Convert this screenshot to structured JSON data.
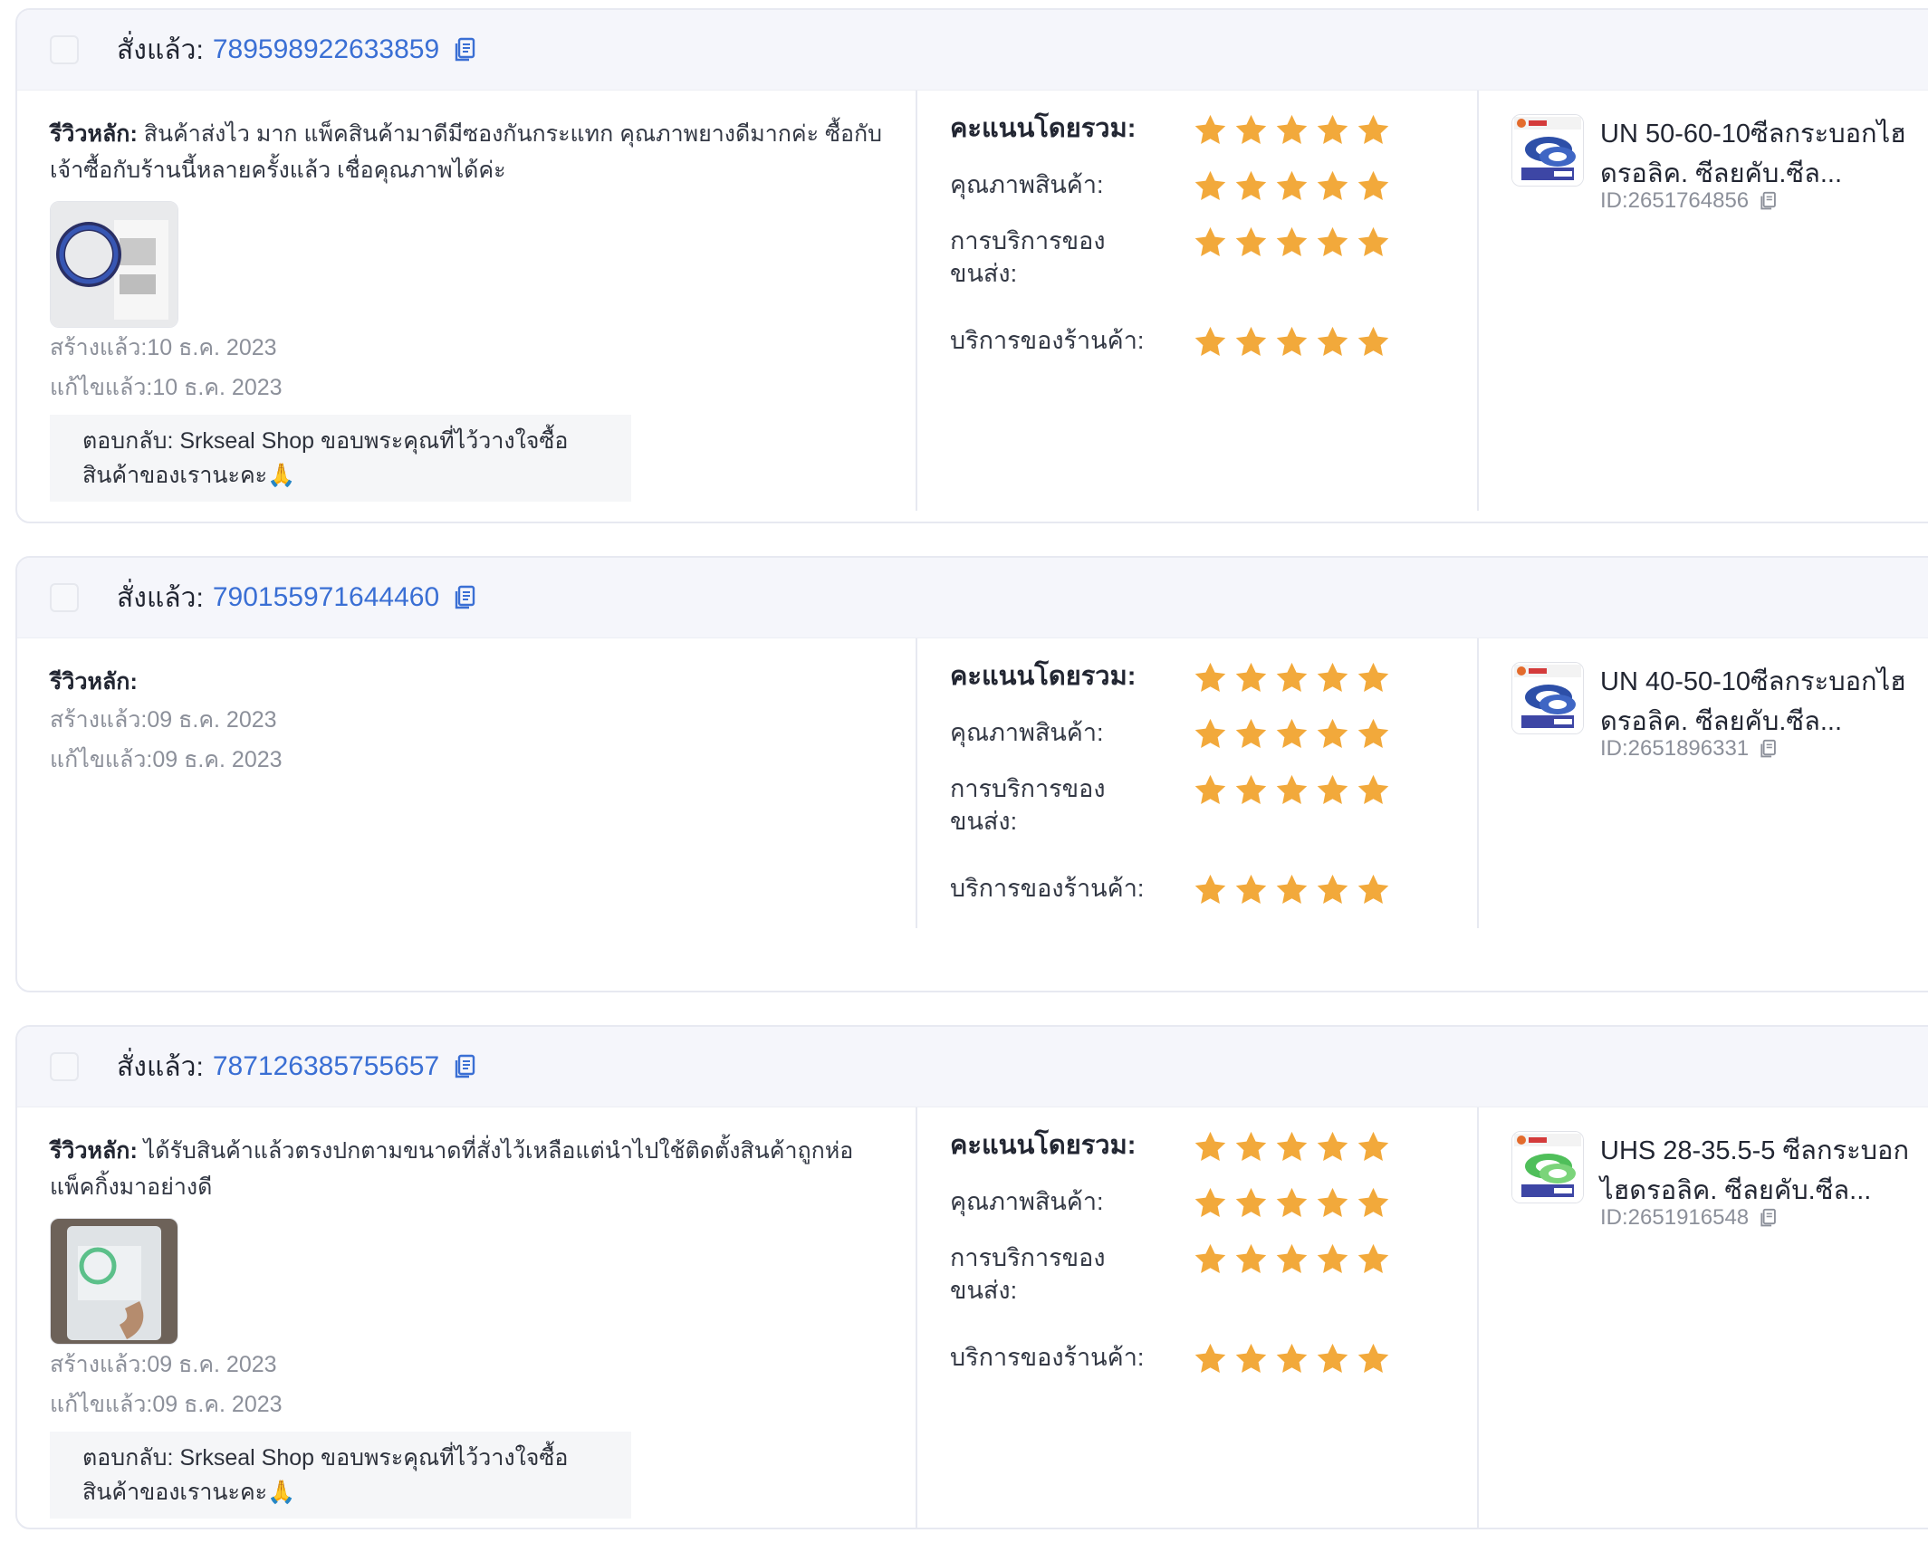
{
  "accent_color": "#3a6fd4",
  "star_color": "#f2a93b",
  "labels": {
    "ordered": "สั่งแล้ว:",
    "main_review": "รีวิวหลัก:",
    "created": "สร้างแล้ว:",
    "edited": "แก้ไขแล้ว:",
    "overall": "คะแนนโดยรวม:",
    "product_quality": "คุณภาพสินค้า:",
    "shipping_service": "การบริการของขนส่ง:",
    "shop_service": "บริการของร้านค้า:",
    "id_prefix": "ID: "
  },
  "reviews": [
    {
      "order_no": "789598922633859",
      "review_text": "สินค้าส่งไว มาก แพ็คสินค้ามาดีมีซองกันกระแทก คุณภาพยางดีมากค่ะ ซื้อกับเจ้าซื้อกับร้านนี้หลายครั้งแล้ว เชื่อคุณภาพได้ค่ะ",
      "has_photo": true,
      "created": "10 ธ.ค. 2023",
      "edited": "10 ธ.ค. 2023",
      "reply": "ตอบกลับ: Srkseal Shop ขอบพระคุณที่ไว้วางใจซื้อสินค้าของเรานะคะ🙏",
      "ratings": {
        "overall": 5,
        "product_quality": 5,
        "shipping_service": 5,
        "shop_service": 5
      },
      "product": {
        "name": "UN 50-60-10ซีลกระบอกไฮดรอลิค. ซีลยคับ.ซีล...",
        "id": "2651764856"
      }
    },
    {
      "order_no": "790155971644460",
      "review_text": "",
      "has_photo": false,
      "created": "09 ธ.ค. 2023",
      "edited": "09 ธ.ค. 2023",
      "reply": "",
      "ratings": {
        "overall": 5,
        "product_quality": 5,
        "shipping_service": 5,
        "shop_service": 5
      },
      "product": {
        "name": "UN 40-50-10ซีลกระบอกไฮดรอลิค. ซีลยคับ.ซีล...",
        "id": "2651896331"
      }
    },
    {
      "order_no": "787126385755657",
      "review_text": "ได้รับสินค้าแล้วตรงปกตามขนาดที่สั่งไว้เหลือแต่นำไปใช้ติดตั้งสินค้าถูกห่อแพ็คกิ้งมาอย่างดี",
      "has_photo": true,
      "created": "09 ธ.ค. 2023",
      "edited": "09 ธ.ค. 2023",
      "reply": "ตอบกลับ: Srkseal Shop ขอบพระคุณที่ไว้วางใจซื้อสินค้าของเรานะคะ🙏",
      "ratings": {
        "overall": 5,
        "product_quality": 5,
        "shipping_service": 5,
        "shop_service": 5
      },
      "product": {
        "name": "UHS 28-35.5-5 ซีลกระบอกไฮดรอลิค. ซีลยคับ.ซีล...",
        "id": "2651916548"
      }
    }
  ]
}
